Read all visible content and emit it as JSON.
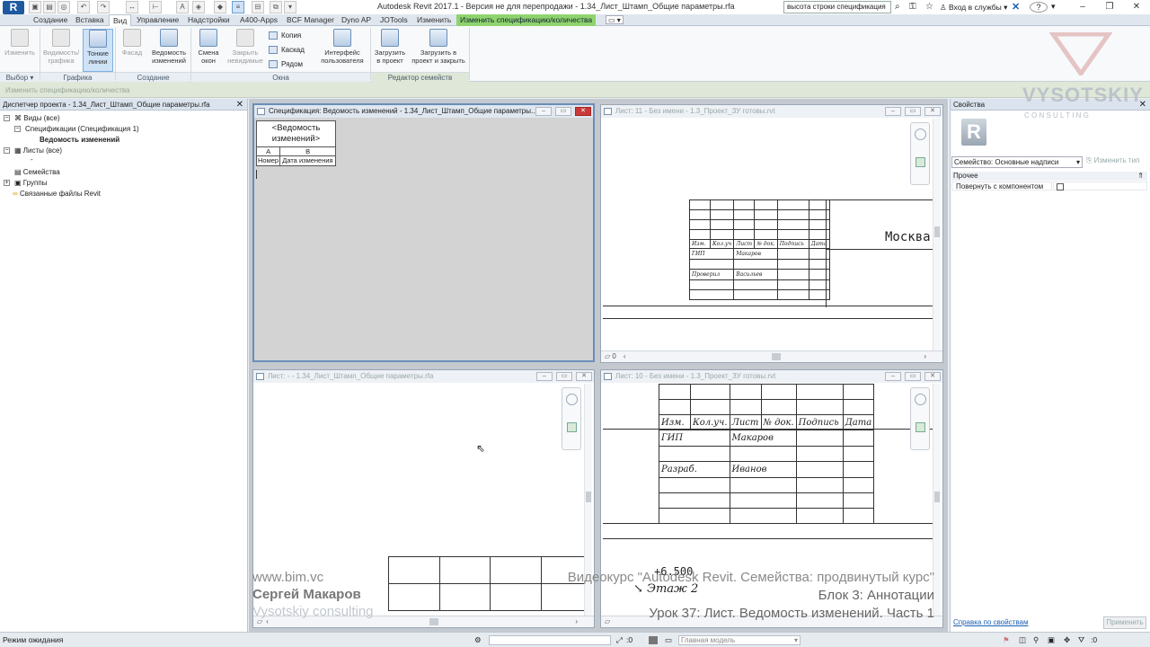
{
  "app": {
    "logo": "R",
    "title": "Autodesk Revit 2017.1 - Версия не для перепродажи -     1.34_Лист_Штамп_Общие параметры.rfa",
    "search_value": "высота строки спецификация",
    "sign_in": "Вход в службы",
    "help": "?"
  },
  "tabs": [
    "Создание",
    "Вставка",
    "Вид",
    "Управление",
    "Надстройки",
    "A400-Apps",
    "BCF Manager",
    "Dyno AP",
    "JOTools",
    "Изменить",
    "Изменить спецификацию/количества"
  ],
  "active_tab": "Вид",
  "ribbon": {
    "modify": "Изменить",
    "visibility": "Видимость/\nграфика",
    "thin_lines": "Тонкие\nлинии",
    "facade": "Фасад",
    "revisions": "Ведомость\nизменений",
    "switch_windows": "Смена\nокон",
    "close_hidden": "Закрыть\nневидимые",
    "copy": "Копия",
    "cascade": "Каскад",
    "tile": "Рядом",
    "user_interface": "Интерфейс\nпользователя",
    "load_into_project": "Загрузить\nв проект",
    "load_and_close": "Загрузить в\nпроект и закрыть",
    "groups": {
      "select": "Выбор",
      "graphics": "Графика",
      "create": "Создание",
      "windows": "Окна",
      "family_editor": "Редактор семейств"
    }
  },
  "options_bar": "Изменить спецификацию/количества",
  "project_browser": {
    "title": "Диспетчер проекта - 1.34_Лист_Штамп_Общие параметры.rfa",
    "items": [
      {
        "label": "Виды (все)",
        "toggle": "−"
      },
      {
        "label": "Спецификации (Спецификация 1)",
        "toggle": "−"
      },
      {
        "label": "Ведомость изменений",
        "toggle": ""
      },
      {
        "label": "Листы (все)",
        "toggle": "−"
      },
      {
        "label": "-",
        "toggle": ""
      },
      {
        "label": "Семейства",
        "toggle": ""
      },
      {
        "label": "Группы",
        "toggle": "+"
      },
      {
        "label": "Связанные файлы Revit",
        "toggle": ""
      }
    ]
  },
  "views": {
    "schedule": {
      "title": "Спецификация: Ведомость изменений - 1.34_Лист_Штамп_Общие параметры...",
      "heading": "<Ведомость изменений>",
      "col_a": "A",
      "col_b": "B",
      "hdr_number": "Номер",
      "hdr_date": "Дата изменения"
    },
    "sheet11": {
      "title": "Лист: 11 - Без имени - 1.3_Проект_ЗУ готовы.rvt",
      "city": "Москва",
      "headers": [
        "Изм.",
        "Кол.уч",
        "Лист",
        "№ док.",
        "Подпись",
        "Дата"
      ],
      "gip": "ГИП",
      "gip_name": "Макаров",
      "checked": "Проверил",
      "checked_name": "Васильев",
      "foot_num": "0"
    },
    "family_sheet": {
      "title": "Лист: - - 1.34_Лист_Штамп_Общие параметры.rfa"
    },
    "sheet10": {
      "title": "Лист: 10 - Без имени - 1.3_Проект_ЗУ готовы.rvt",
      "headers": [
        "Изм.",
        "Кол.уч.",
        "Лист",
        "№ док.",
        "Подпись",
        "Дата"
      ],
      "gip": "ГИП",
      "gip_name": "Макаров",
      "developed": "Разраб.",
      "developed_name": "Иванов",
      "level_value": "+6.500",
      "level_name": "Этаж 2"
    }
  },
  "properties": {
    "title": "Свойства",
    "type_selector": "Семейство: Основные надписи",
    "edit_type": "Изменить тип",
    "category": "Прочее",
    "param_name": "Повернуть с компонентом",
    "help_link": "Справка по свойствам",
    "apply": "Применить"
  },
  "watermark": {
    "brand": "VYSOTSKIY",
    "sub": "C O N S U L T I N G",
    "site": "www.bim.vc",
    "author": "Сергей Макаров",
    "company": "Vysotskiy consulting",
    "course": "Видеокурс \"Autodesk Revit. Семейства: продвинутый курс\"",
    "block": "Блок 3: Аннотации",
    "lesson": "Урок 37: Лист. Ведомость изменений. Часть 1"
  },
  "status": {
    "left": "Режим ожидания",
    "count": ":0",
    "model": "Главная модель",
    "filter": ":0"
  }
}
